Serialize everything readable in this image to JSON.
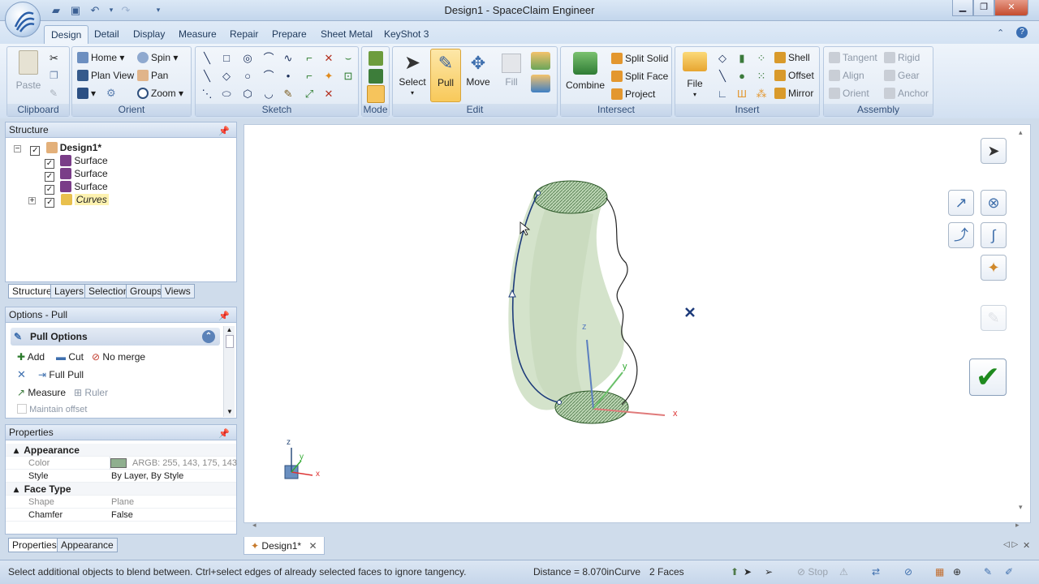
{
  "app": {
    "title": "Design1 - SpaceClaim Engineer",
    "qat_icons": [
      "open-folder-icon",
      "save-icon",
      "undo-icon",
      "redo-icon",
      "customize-icon"
    ]
  },
  "tabs": [
    "Design",
    "Detail",
    "Display",
    "Measure",
    "Repair",
    "Prepare",
    "Sheet Metal",
    "KeyShot 3"
  ],
  "ribbon": {
    "clipboard": {
      "label": "Clipboard",
      "paste": "Paste"
    },
    "orient": {
      "label": "Orient",
      "home": "Home",
      "spin": "Spin",
      "plan_view": "Plan View",
      "pan": "Pan",
      "zoom": "Zoom"
    },
    "sketch": {
      "label": "Sketch"
    },
    "mode": {
      "label": "Mode"
    },
    "edit": {
      "label": "Edit",
      "select": "Select",
      "pull": "Pull",
      "move": "Move",
      "fill": "Fill"
    },
    "intersect": {
      "label": "Intersect",
      "combine": "Combine",
      "split_solid": "Split Solid",
      "split_face": "Split Face",
      "project": "Project"
    },
    "insert": {
      "label": "Insert",
      "file": "File",
      "shell": "Shell",
      "offset": "Offset",
      "mirror": "Mirror"
    },
    "assembly": {
      "label": "Assembly",
      "tangent": "Tangent",
      "rigid": "Rigid",
      "align": "Align",
      "gear": "Gear",
      "orient": "Orient",
      "anchor": "Anchor"
    }
  },
  "structure": {
    "title": "Structure",
    "items": [
      {
        "label": "Design1*",
        "level": 0
      },
      {
        "label": "Surface",
        "level": 1
      },
      {
        "label": "Surface",
        "level": 1
      },
      {
        "label": "Surface",
        "level": 1
      },
      {
        "label": "Curves",
        "level": 1
      }
    ],
    "tabs": [
      "Structure",
      "Layers",
      "Selection",
      "Groups",
      "Views"
    ]
  },
  "options": {
    "title": "Options - Pull",
    "section": "Pull Options",
    "add": "Add",
    "cut": "Cut",
    "no_merge": "No merge",
    "full_pull": "Full Pull",
    "measure": "Measure",
    "ruler": "Ruler",
    "maintain_offset": "Maintain offset"
  },
  "properties": {
    "title": "Properties",
    "groups": [
      {
        "name": "Appearance",
        "rows": [
          {
            "key": "Color",
            "value": "ARGB: 255, 143, 175, 143",
            "dim": true
          },
          {
            "key": "Style",
            "value": "By Layer, By Style",
            "dim": false
          }
        ]
      },
      {
        "name": "Face Type",
        "rows": [
          {
            "key": "Shape",
            "value": "Plane",
            "dim": true
          },
          {
            "key": "Chamfer",
            "value": "False",
            "dim": false
          }
        ]
      }
    ],
    "color_swatch": "#8faf8f",
    "tabs": [
      "Properties",
      "Appearance"
    ]
  },
  "document_tab": "Design1*",
  "axes": {
    "x": "x",
    "y": "y",
    "z": "z"
  },
  "status": {
    "message": "Select additional objects to blend between. Ctrl+select edges of already selected faces to ignore tangency.",
    "distance": "Distance = 8.070in",
    "curve": "Curve",
    "faces": "2 Faces",
    "stop": "Stop"
  },
  "colors": {
    "accent": "#f7c35a",
    "surface": "#d4e3cb",
    "edge": "#1d3b7a"
  }
}
